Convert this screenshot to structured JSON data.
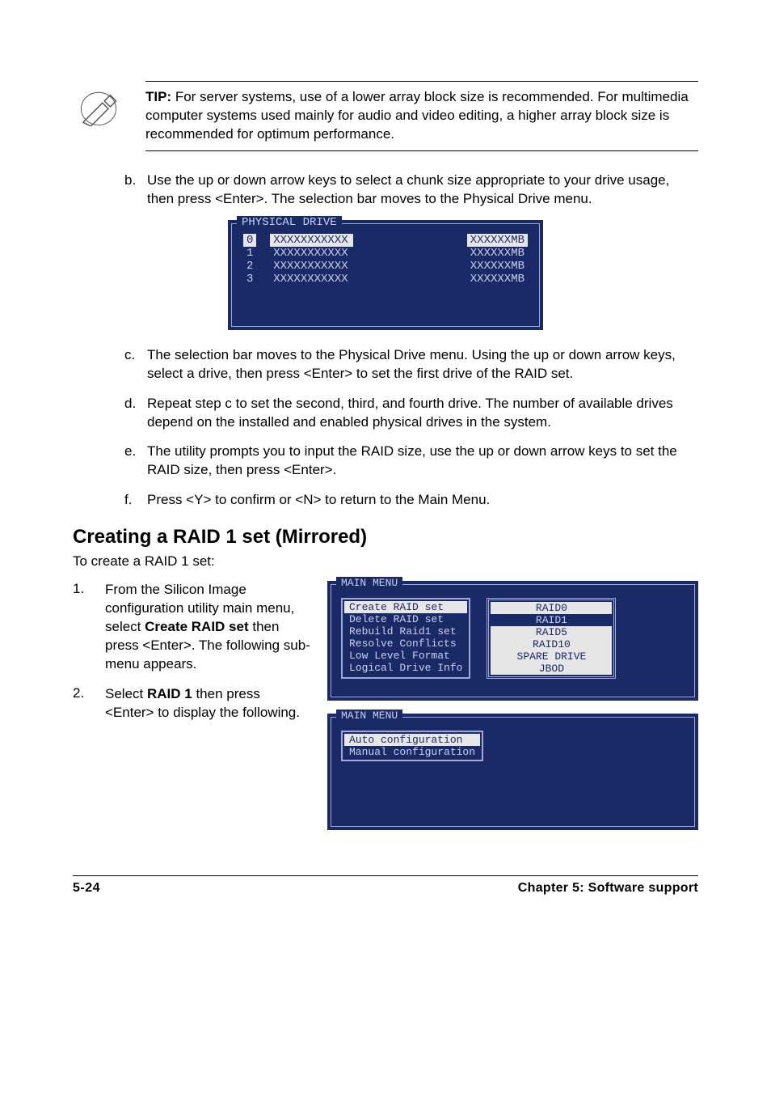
{
  "tip": {
    "label": "TIP:",
    "text": " For server systems, use of a lower array block size is recommended. For multimedia computer systems used mainly for audio and video editing, a higher array block size is recommended for optimum performance."
  },
  "lettered": [
    {
      "marker": "b.",
      "text": "Use the up or down arrow keys to select a chunk size appropriate to your drive usage, then press <Enter>. The selection bar moves to the Physical Drive menu."
    },
    {
      "marker": "c.",
      "text": "The selection bar moves to the Physical Drive menu. Using the up or down arrow keys, select a drive, then press <Enter> to set the first drive of the RAID set."
    },
    {
      "marker": "d.",
      "text": "Repeat step c to set the second, third, and fourth drive. The number of available drives depend on the installed and enabled physical drives in the system."
    },
    {
      "marker": "e.",
      "text": "The utility prompts you to input the RAID size, use the up or down arrow keys to set the RAID size, then press <Enter>."
    },
    {
      "marker": "f.",
      "text": "Press <Y> to confirm or <N> to return to the Main Menu."
    }
  ],
  "phys_drive": {
    "title": "PHYSICAL DRIVE",
    "rows": [
      {
        "idx": "0",
        "name": "XXXXXXXXXXX",
        "size": "XXXXXXMB",
        "sel": true
      },
      {
        "idx": "1",
        "name": "XXXXXXXXXXX",
        "size": "XXXXXXMB",
        "sel": false
      },
      {
        "idx": "2",
        "name": "XXXXXXXXXXX",
        "size": "XXXXXXMB",
        "sel": false
      },
      {
        "idx": "3",
        "name": "XXXXXXXXXXX",
        "size": "XXXXXXMB",
        "sel": false
      }
    ]
  },
  "heading": "Creating a RAID 1 set (Mirrored)",
  "intro": "To create a RAID 1 set:",
  "steps": {
    "1": {
      "marker": "1.",
      "pre": "From the Silicon Image configuration utility main menu, select ",
      "bold": "Create RAID set",
      "post": " then press <Enter>. The following sub-menu appears."
    },
    "2": {
      "marker": "2.",
      "pre": "Select ",
      "bold": "RAID 1",
      "post": " then press <Enter> to display the following."
    }
  },
  "main_menu1": {
    "title": "MAIN MENU",
    "left": [
      {
        "label": "Create RAID set",
        "sel": true
      },
      {
        "label": "Delete RAID set",
        "sel": false
      },
      {
        "label": "Rebuild Raid1 set",
        "sel": false
      },
      {
        "label": "Resolve Conflicts",
        "sel": false
      },
      {
        "label": "Low Level Format",
        "sel": false
      },
      {
        "label": "Logical Drive Info",
        "sel": false
      }
    ],
    "right": [
      {
        "label": "RAID0",
        "sel": true
      },
      {
        "label": "RAID1",
        "sel": false
      },
      {
        "label": "RAID5",
        "sel": true
      },
      {
        "label": "RAID10",
        "sel": true
      },
      {
        "label": "SPARE DRIVE",
        "sel": true
      },
      {
        "label": "JBOD",
        "sel": true
      }
    ]
  },
  "main_menu2": {
    "title": "MAIN MENU",
    "left": [
      {
        "label": "Auto configuration",
        "sel": true
      },
      {
        "label": "Manual configuration",
        "sel": false
      }
    ]
  },
  "footer": {
    "left": "5-24",
    "right": "Chapter 5: Software support"
  }
}
